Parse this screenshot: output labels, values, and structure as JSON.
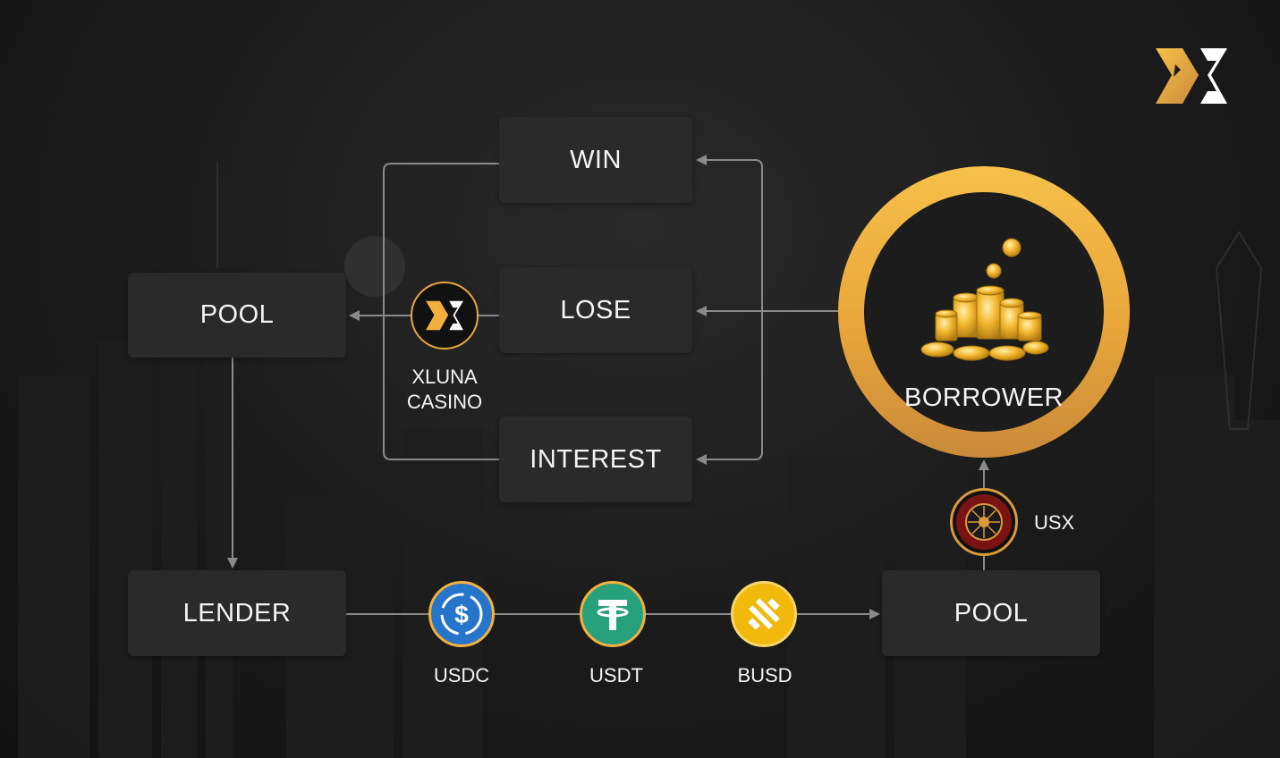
{
  "nodes": {
    "win": "WIN",
    "lose": "LOSE",
    "interest": "INTEREST",
    "pool_left": "POOL",
    "lender": "LENDER",
    "pool_right": "POOL",
    "borrower": "BORROWER"
  },
  "casino": {
    "line1": "XLUNA",
    "line2": "CASINO"
  },
  "coins": [
    {
      "label": "USDC",
      "color": "#2775ca",
      "icon": "usdc-icon"
    },
    {
      "label": "USDT",
      "color": "#26a17b",
      "icon": "usdt-icon"
    },
    {
      "label": "BUSD",
      "color": "#f0b90b",
      "icon": "busd-icon"
    }
  ],
  "usx": {
    "label": "USX",
    "chip_text": "XLUNA CASINO USX"
  },
  "colors": {
    "gold": "#f2b13f",
    "box": "#2a2a2a",
    "line": "#8a8a8a"
  }
}
